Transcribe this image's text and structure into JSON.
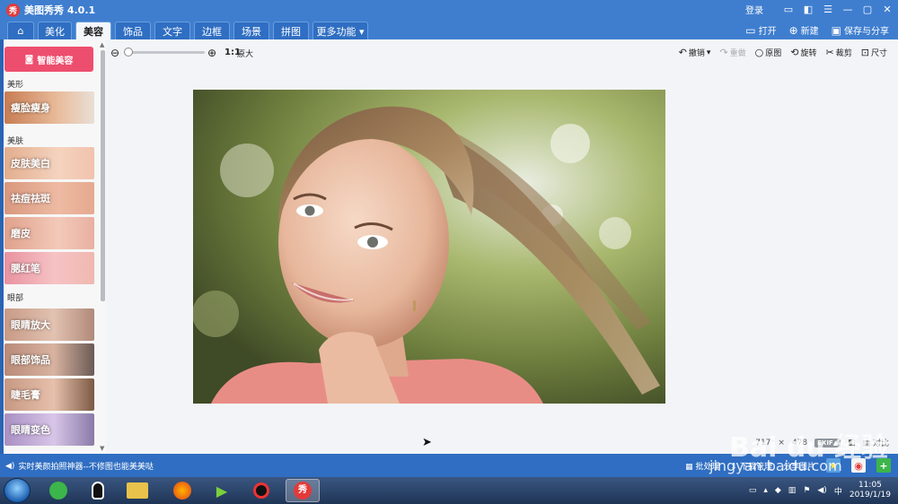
{
  "app": {
    "title": "美图秀秀 4.0.1",
    "logo_text": "秀",
    "login": "登录"
  },
  "tabs": [
    {
      "label": "美化"
    },
    {
      "label": "美容"
    },
    {
      "label": "饰品"
    },
    {
      "label": "文字"
    },
    {
      "label": "边框"
    },
    {
      "label": "场景"
    },
    {
      "label": "拼图"
    },
    {
      "label": "更多功能 ▾"
    }
  ],
  "active_tab": "美容",
  "top_actions": {
    "open": "打开",
    "new": "新建",
    "save": "保存与分享"
  },
  "left_panel": {
    "smart_button": "智能美容",
    "sections": {
      "shape": "美形",
      "skin": "美肤",
      "eyes": "眼部"
    },
    "items": [
      {
        "label": "瘦脸瘦身"
      },
      {
        "label": "皮肤美白"
      },
      {
        "label": "祛痘祛斑"
      },
      {
        "label": "磨皮"
      },
      {
        "label": "腮红笔"
      },
      {
        "label": "眼睛放大"
      },
      {
        "label": "眼部饰品"
      },
      {
        "label": "睫毛膏"
      },
      {
        "label": "眼睛变色"
      }
    ]
  },
  "toolbar": {
    "ratio": "1:1",
    "original_size": "原大",
    "undo": "撤销",
    "redo": "重做",
    "original": "原图",
    "rotate": "旋转",
    "crop": "裁剪",
    "size": "尺寸"
  },
  "image_info": {
    "width": "717",
    "sep": "×",
    "height": "478",
    "exif": "EXIF▲",
    "compare": "对比"
  },
  "status": {
    "marquee": "实时美颜拍照神器--不修图也能美美哒",
    "batch": "批处理",
    "download": "下载管理",
    "share": "分享图片"
  },
  "watermark": {
    "main": "Bai du 经验",
    "url": "jingyan.baidu.com"
  },
  "clock": {
    "time": "11:05",
    "date": "2019/1/19"
  },
  "colors": {
    "accent": "#3f7ecf",
    "smart_button": "#ee4e6e",
    "panel_bg": "#f2f4f7"
  }
}
